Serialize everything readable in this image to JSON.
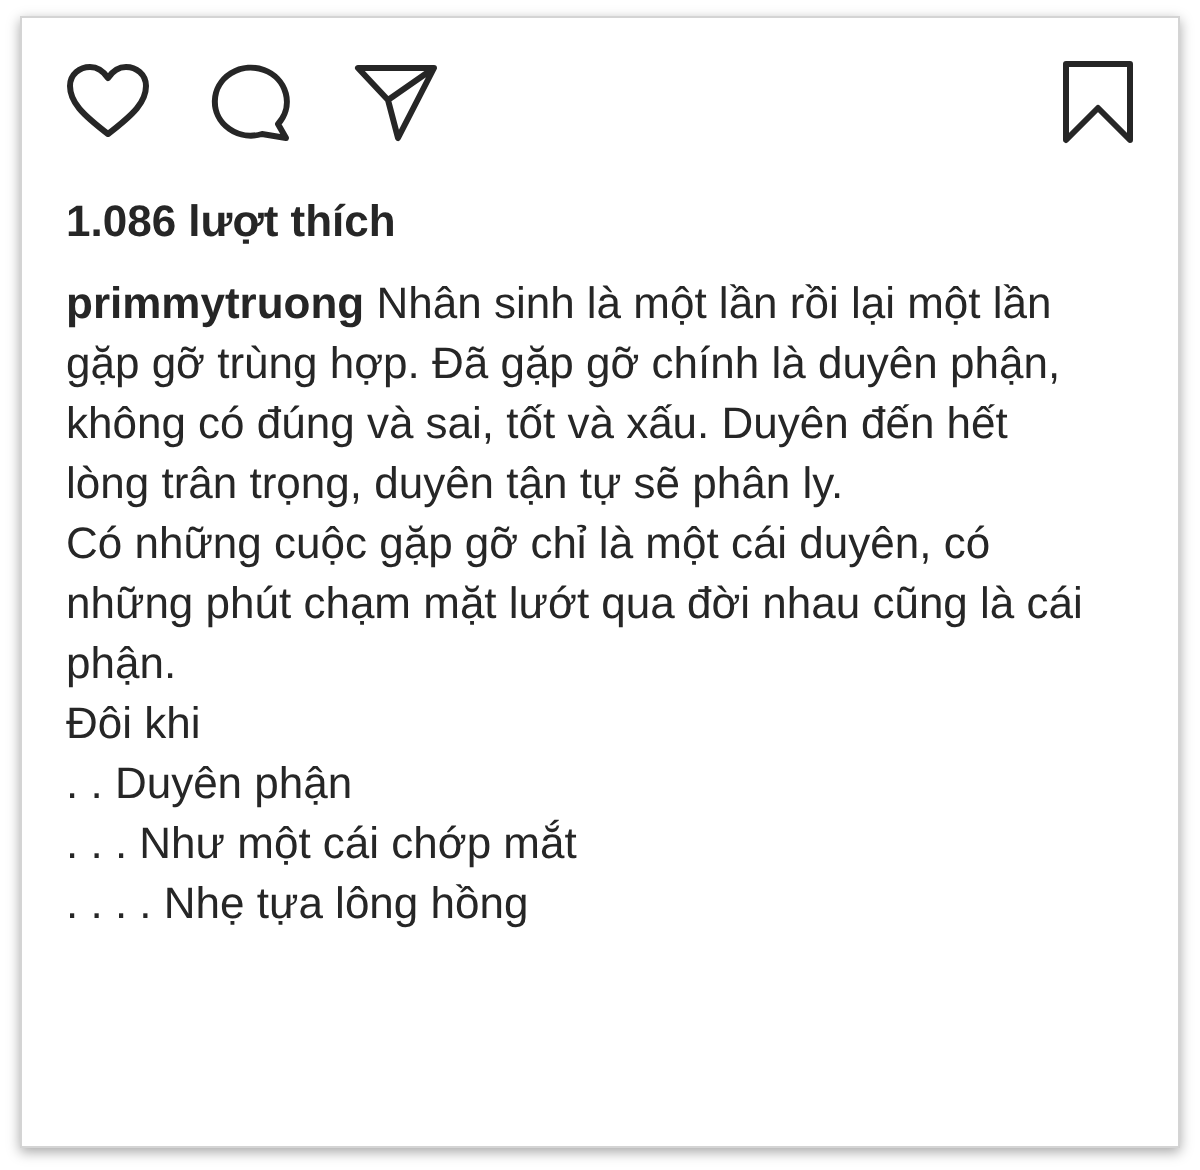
{
  "actions": {
    "liked": false,
    "saved": false
  },
  "likes": "1.086 lượt thích",
  "caption": {
    "username": "primmytruong",
    "paragraphs": [
      "Nhân sinh là một lần rồi lại một lần gặp gỡ trùng hợp. Đã gặp gỡ chính là duyên phận, không có đúng và sai, tốt và xấu. Duyên đến hết lòng trân trọng, duyên tận tự sẽ phân ly.",
      "Có những cuộc gặp gỡ chỉ là một cái duyên, có những phút chạm mặt lướt qua đời nhau cũng là cái phận.",
      "Đôi khi",
      ". . Duyên phận",
      ". . . Như một cái chớp mắt",
      ". . . . Nhẹ tựa lông hồng"
    ]
  }
}
